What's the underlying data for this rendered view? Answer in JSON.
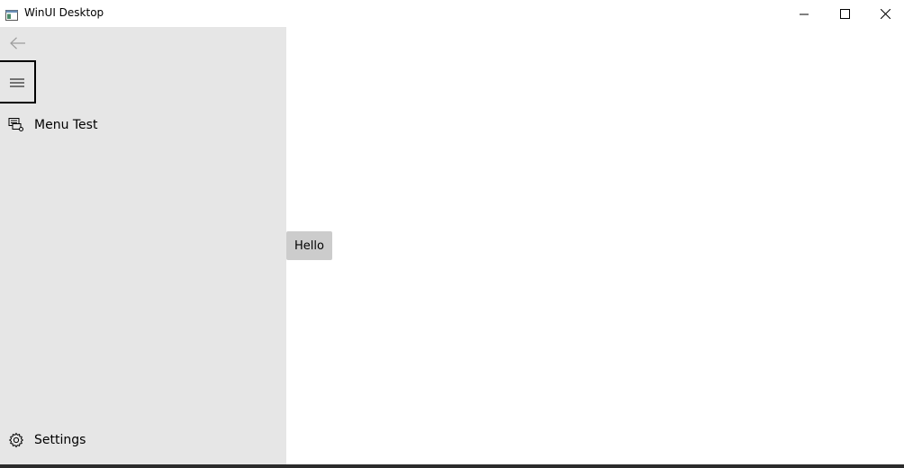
{
  "window": {
    "title": "WinUI Desktop",
    "icon": "app-window-icon",
    "controls": [
      "minimize-icon",
      "maximize-icon",
      "close-icon"
    ]
  },
  "nav": {
    "back_icon": "back-arrow-icon",
    "toggle_icon": "hamburger-icon",
    "items": [
      {
        "label": "Menu Test",
        "icon": "menu-test-icon"
      }
    ],
    "footer": {
      "label": "Settings",
      "icon": "gear-icon"
    }
  },
  "content": {
    "button_label": "Hello"
  },
  "colors": {
    "nav_background": "#e6e6e6",
    "content_background": "#ffffff",
    "button_background": "#cccccc",
    "focus_border": "#000000"
  }
}
